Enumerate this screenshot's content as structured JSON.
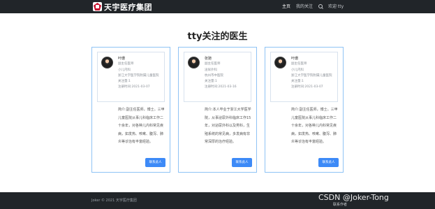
{
  "nav": {
    "brand": "天宇医疗集团",
    "home": "主页",
    "my_follows": "我的关注",
    "welcome": "欢迎  tty",
    "search_icon": "search-icon"
  },
  "page": {
    "title": "tty关注的医生"
  },
  "doctors": [
    {
      "name": "叶珊",
      "title": "副主任医师",
      "dept": "小儿内科",
      "hospital": "浙江大学医学院附属儿童医院",
      "follow": "关注量:1",
      "registered": "注册时间:2021-03-07",
      "intro": "简介:副主任医师，博士。三甲儿童医院从事儿科临床工作二十余年，对各种儿内科常见疾病，如发热、咳嗽、腹泻、肺炎等诊治有丰富经验。",
      "cta": "联系此人"
    },
    {
      "name": "张驰",
      "title": "副主任医师",
      "dept": "泌尿外科",
      "hospital": "杭州市中医院",
      "follow": "关注量:1",
      "registered": "注册时间:2021-03-16",
      "intro": "简介:本人毕业于浙江大学医学院，从事泌尿外科临床工作15年，对泌尿外科以及男科，生殖系统的常见病，多发病有非常深厚的治疗经验。",
      "cta": "联系此人"
    },
    {
      "name": "叶珊",
      "title": "副主任医师",
      "dept": "小儿内科",
      "hospital": "浙江大学医学院附属儿童医院",
      "follow": "关注量:1",
      "registered": "注册时间:2021-03-07",
      "intro": "简介:副主任医师，博士。三甲儿童医院从事儿科临床工作二十余年，对各种儿内科常见疾病，如发热、咳嗽、腹泻、肺炎等诊治有丰富经验。",
      "cta": "联系此人"
    }
  ],
  "footer": {
    "copyright": "Joker © 2021 天宇医疗集团",
    "link": "联系作者",
    "watermark": "CSDN @Joker-Tong"
  }
}
